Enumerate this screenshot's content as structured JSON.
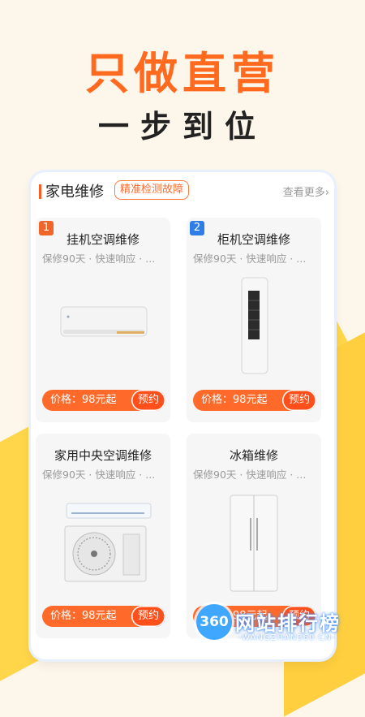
{
  "hero": {
    "title": "只做直营",
    "subtitle": "一步到位"
  },
  "section": {
    "title": "家电维修",
    "tag": "精准检测故障",
    "more": "查看更多›"
  },
  "cards": [
    {
      "badge": "1",
      "badge_color": "#f0652a",
      "title": "挂机空调维修",
      "desc": "保修90天 · 快速响应 · ...",
      "price": "价格：98元起",
      "button": "预约",
      "image": "wall-ac-image"
    },
    {
      "badge": "2",
      "badge_color": "#2f7ee8",
      "title": "柜机空调维修",
      "desc": "保修90天 · 快速响应 · ...",
      "price": "价格：98元起",
      "button": "预约",
      "image": "floor-ac-image"
    },
    {
      "badge": "",
      "title": "家用中央空调维修",
      "desc": "保修90天 · 快速响应 · ...",
      "price": "价格：98元起",
      "button": "预约",
      "image": "central-ac-image"
    },
    {
      "badge": "",
      "title": "冰箱维修",
      "desc": "保修90天 · 快速响应 · ...",
      "price": "价格：98元起",
      "button": "预约",
      "image": "fridge-image"
    }
  ],
  "watermark": {
    "logo": "360",
    "text": "网站排行榜",
    "url": "-WANGZHAN360.CN-"
  },
  "colors": {
    "accent": "#ff6a1f",
    "button": "#ff4f1a",
    "bg_yellow": "#ffd54a"
  }
}
